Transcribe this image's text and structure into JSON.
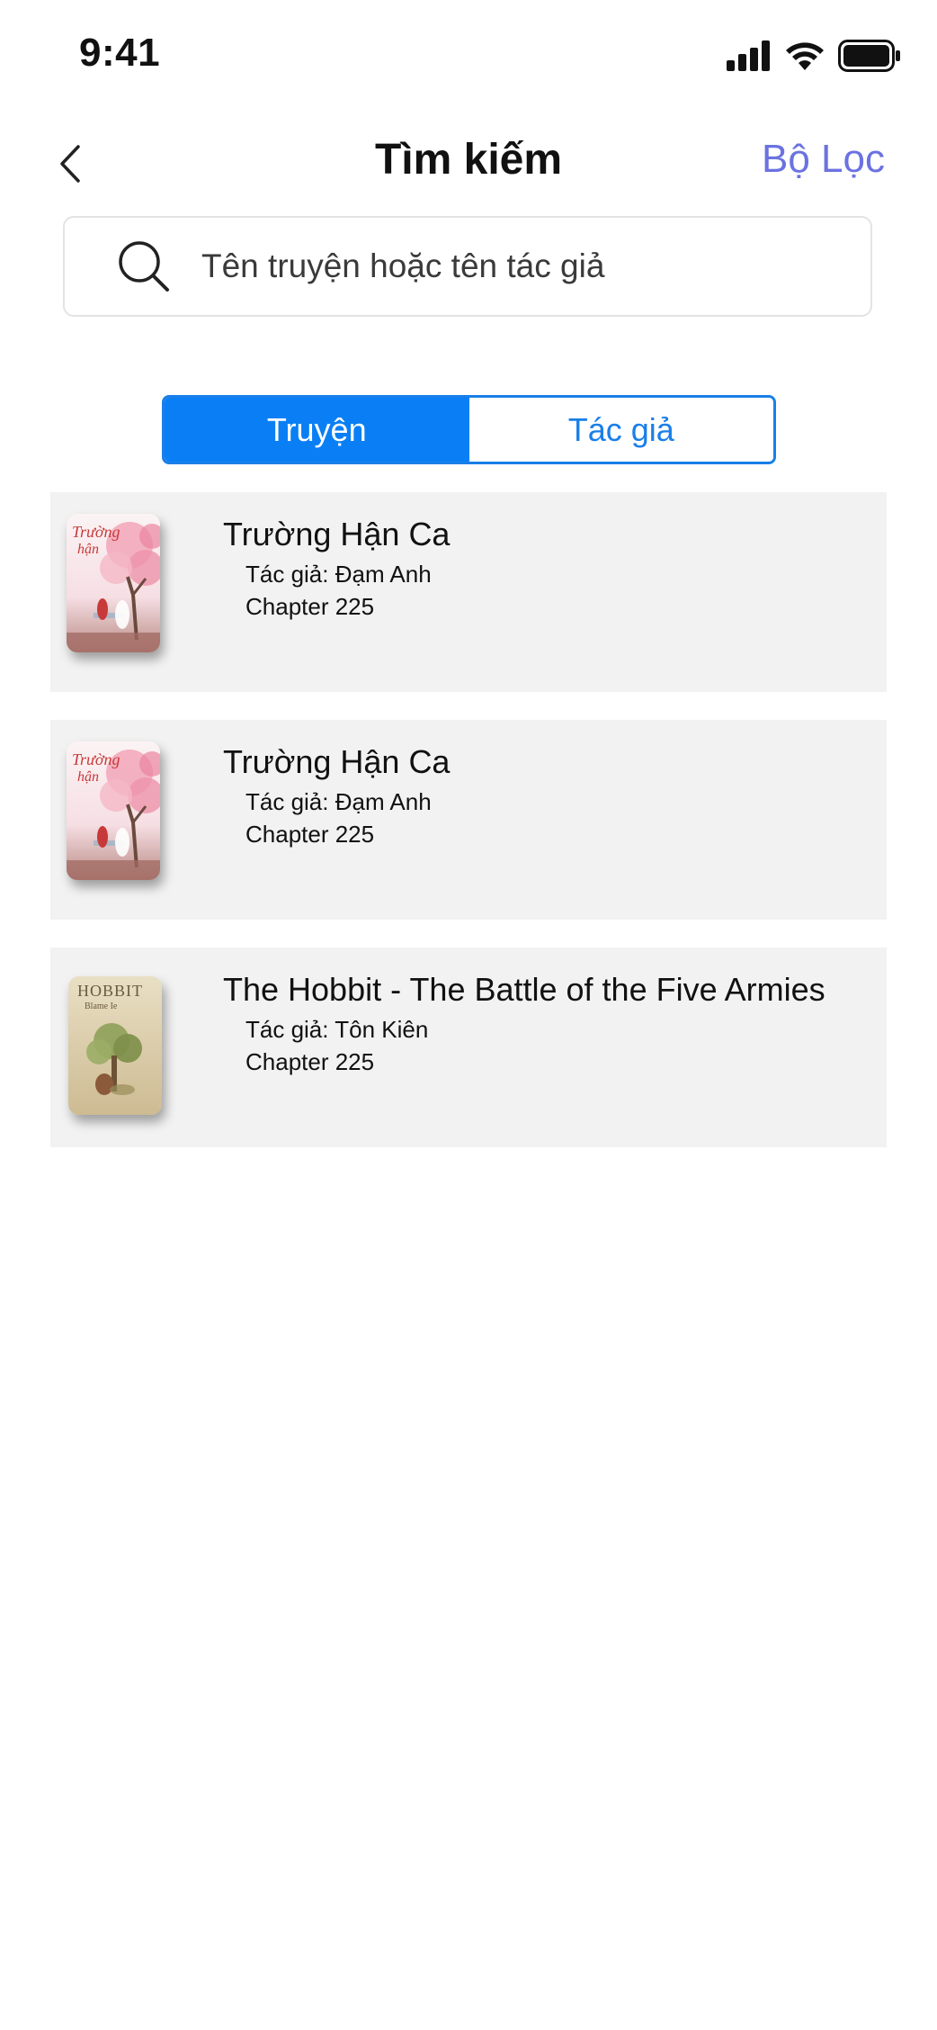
{
  "status_bar": {
    "time": "9:41"
  },
  "nav": {
    "title": "Tìm kiếm",
    "filter_label": "Bộ Lọc",
    "back_icon": "chevron-left-icon"
  },
  "search": {
    "placeholder": "Tên truyện hoặc tên tác giả",
    "value": "",
    "icon": "search-icon"
  },
  "tabs": [
    {
      "label": "Truyện",
      "active": true
    },
    {
      "label": "Tác giả",
      "active": false
    }
  ],
  "results": [
    {
      "title": "Trường Hận Ca",
      "author": "Tác giả: Đạm Anh",
      "chapter": "Chapter 225",
      "cover": "pink-blossom-cover"
    },
    {
      "title": "Trường Hận Ca",
      "author": "Tác giả: Đạm Anh",
      "chapter": "Chapter 225",
      "cover": "pink-blossom-cover"
    },
    {
      "title": "The Hobbit - The Battle of the Five Armies",
      "author": "Tác giả: Tôn Kiên",
      "chapter": "Chapter 225",
      "cover": "hobbit-tree-cover"
    }
  ],
  "colors": {
    "accent": "#0a7ff5",
    "filter": "#6b72e0",
    "item_background": "#f2f2f2"
  }
}
